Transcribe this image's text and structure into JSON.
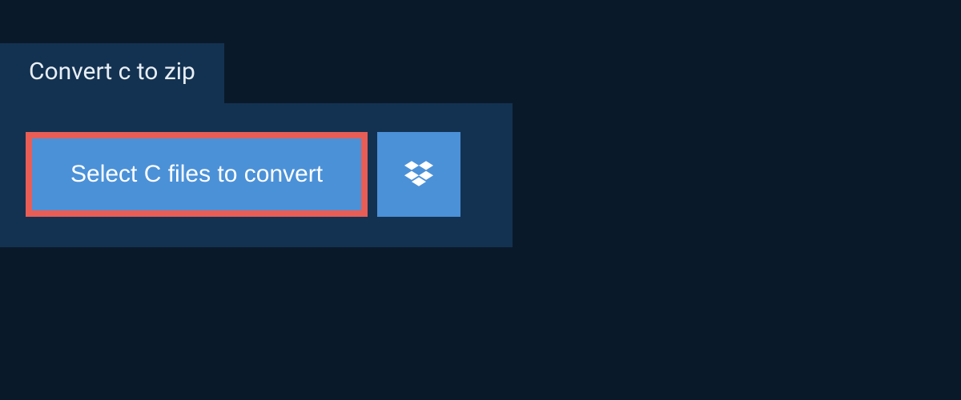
{
  "tab": {
    "title": "Convert c to zip"
  },
  "actions": {
    "select_button_label": "Select C files to convert"
  },
  "colors": {
    "background": "#0a1929",
    "panel": "#133251",
    "accent": "#4b91d8",
    "highlight_border": "#e85d56",
    "text": "#ffffff"
  }
}
